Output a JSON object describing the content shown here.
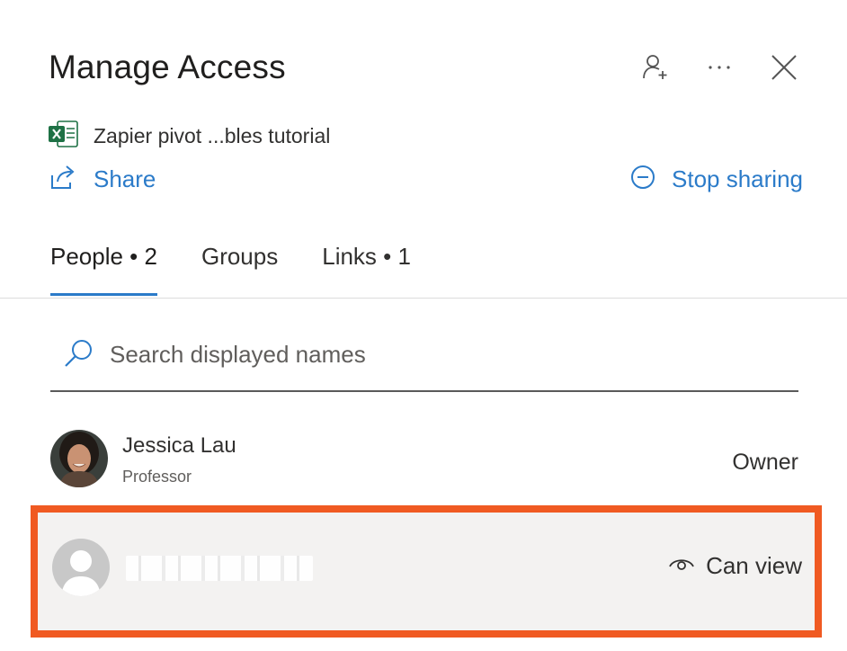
{
  "header": {
    "title": "Manage Access",
    "icons": [
      "add-person-icon",
      "more-options-icon",
      "close-icon"
    ]
  },
  "file": {
    "icon": "excel-file-icon",
    "name": "Zapier pivot ...bles tutorial"
  },
  "actions": {
    "share_label": "Share",
    "stop_sharing_label": "Stop sharing"
  },
  "tabs": [
    {
      "label": "People • 2",
      "active": true
    },
    {
      "label": "Groups",
      "active": false
    },
    {
      "label": "Links • 1",
      "active": false
    }
  ],
  "search": {
    "placeholder": "Search displayed names",
    "value": ""
  },
  "people": [
    {
      "name": "Jessica Lau",
      "role": "Professor",
      "permission": "Owner"
    },
    {
      "name": "",
      "role": "",
      "permission": "Can view",
      "permission_icon": "eye-icon"
    }
  ],
  "colors": {
    "accent": "#2b7bc9",
    "highlight_border": "#f05a22",
    "excel_green": "#1e7145"
  }
}
